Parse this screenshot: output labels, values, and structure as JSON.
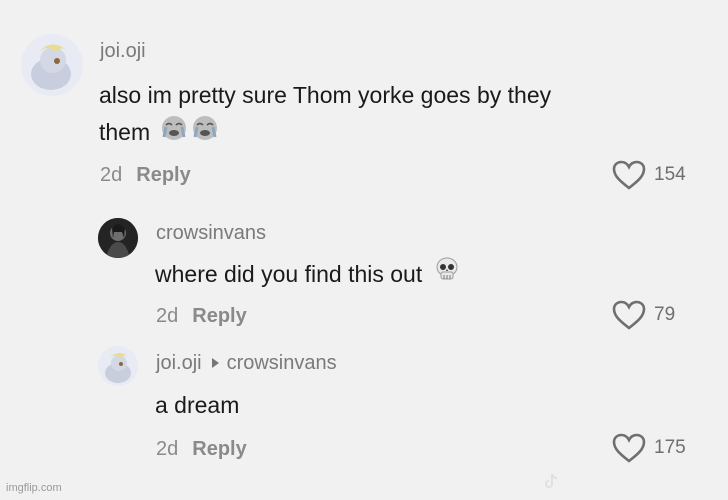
{
  "comments": [
    {
      "username": "joi.oji",
      "text_line1": "also im pretty sure Thom yorke goes by they",
      "text_line2": "them",
      "age": "2d",
      "reply_label": "Reply",
      "likes": "154",
      "emoji": "crying-face-icon"
    },
    {
      "username": "crowsinvans",
      "text": "where did you find this out",
      "age": "2d",
      "reply_label": "Reply",
      "likes": "79",
      "emoji": "skull-icon"
    },
    {
      "username": "joi.oji",
      "reply_to": "crowsinvans",
      "text": "a dream",
      "age": "2d",
      "reply_label": "Reply",
      "likes": "175"
    }
  ],
  "footer": {
    "imgflip": "imgflip.com"
  },
  "colors": {
    "background": "#f1f1f1",
    "text": "#1a1a1a",
    "muted": "#8a8a8a"
  }
}
